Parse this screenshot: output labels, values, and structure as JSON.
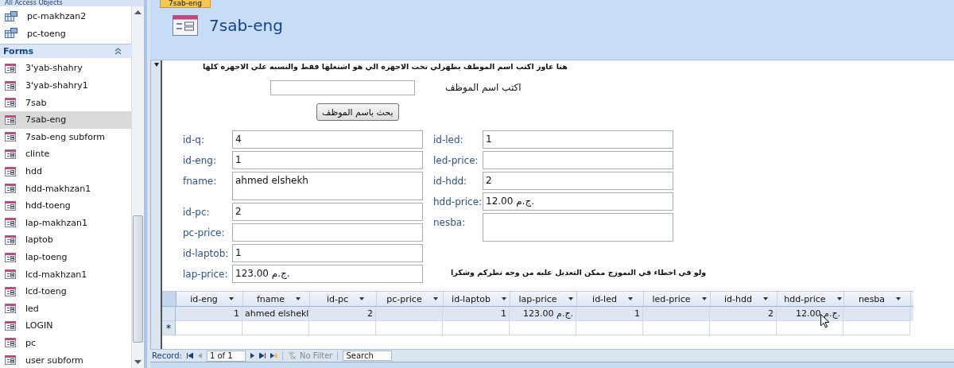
{
  "sidebar": {
    "title": "All Access Objects",
    "items": [
      {
        "label": "pc-makhzan2",
        "kind": "table",
        "selected": false
      },
      {
        "label": "pc-toeng",
        "kind": "table",
        "selected": false
      },
      {
        "label": "Forms",
        "kind": "group",
        "expanded": true
      },
      {
        "label": "3'yab-shahry",
        "kind": "form",
        "selected": false
      },
      {
        "label": "3'yab-shahry1",
        "kind": "form",
        "selected": false
      },
      {
        "label": "7sab",
        "kind": "form",
        "selected": false
      },
      {
        "label": "7sab-eng",
        "kind": "form",
        "selected": true
      },
      {
        "label": "7sab-eng subform",
        "kind": "form",
        "selected": false
      },
      {
        "label": "clinte",
        "kind": "form",
        "selected": false
      },
      {
        "label": "hdd",
        "kind": "form",
        "selected": false
      },
      {
        "label": "hdd-makhzan1",
        "kind": "form",
        "selected": false
      },
      {
        "label": "hdd-toeng",
        "kind": "form",
        "selected": false
      },
      {
        "label": "lap-makhzan1",
        "kind": "form",
        "selected": false
      },
      {
        "label": "laptob",
        "kind": "form",
        "selected": false
      },
      {
        "label": "lap-toeng",
        "kind": "form",
        "selected": false
      },
      {
        "label": "lcd-makhzan1",
        "kind": "form",
        "selected": false
      },
      {
        "label": "lcd-toeng",
        "kind": "form",
        "selected": false
      },
      {
        "label": "led",
        "kind": "form",
        "selected": false
      },
      {
        "label": "LOGIN",
        "kind": "form",
        "selected": false
      },
      {
        "label": "pc",
        "kind": "form",
        "selected": false
      },
      {
        "label": "user subform",
        "kind": "form",
        "selected": false
      }
    ]
  },
  "document_tab": {
    "label": "7sab-eng"
  },
  "form": {
    "title": "7sab-eng",
    "instruction": "هنا عاوز اكتب اسم الموظف يظهرلي تحت الاجهزه الي هو اشتغلها فقط والنسبه علي الاجهزه كلها",
    "search_label": "اكتب اسم الموظف",
    "search_button": "بحث باسم الموظف",
    "left_fields": [
      {
        "label": "id-q:",
        "value": "4",
        "kind": "single"
      },
      {
        "label": "id-eng:",
        "value": "1",
        "kind": "single"
      },
      {
        "label": "fname:",
        "value": "ahmed elshekh",
        "kind": "multi"
      },
      {
        "label": "id-pc:",
        "value": "2",
        "kind": "single"
      },
      {
        "label": "pc-price:",
        "kind": "single"
      },
      {
        "label": "id-laptob:",
        "value": "1",
        "kind": "single"
      },
      {
        "label": "lap-price:",
        "value": "123.00 ج.م.",
        "kind": "single"
      }
    ],
    "right_fields": [
      {
        "label": "id-led:",
        "value": "1",
        "kind": "single"
      },
      {
        "label": "led-price:",
        "kind": "single"
      },
      {
        "label": "id-hdd:",
        "value": "2",
        "kind": "single"
      },
      {
        "label": "hdd-price:",
        "value": "12.00 ج.م.",
        "kind": "single"
      },
      {
        "label": "nesba:",
        "kind": "multi"
      }
    ],
    "note": "ولو في اخطاء في النموزج ممكن التعديل عليه من وجه نظركم وشكرا"
  },
  "datasheet": {
    "columns": [
      {
        "label": "id-eng",
        "kind": "number"
      },
      {
        "label": "fname",
        "kind": "text"
      },
      {
        "label": "id-pc",
        "kind": "number"
      },
      {
        "label": "pc-price",
        "kind": "number"
      },
      {
        "label": "id-laptob",
        "kind": "number"
      },
      {
        "label": "lap-price",
        "kind": "number"
      },
      {
        "label": "id-led",
        "kind": "number"
      },
      {
        "label": "led-price",
        "kind": "number"
      },
      {
        "label": "id-hdd",
        "kind": "number"
      },
      {
        "label": "hdd-price",
        "kind": "number"
      },
      {
        "label": "nesba",
        "kind": "number"
      }
    ],
    "rows": [
      {
        "cells": [
          "1",
          "ahmed elshekl",
          "2",
          null,
          "1",
          "123.00 ج.م.",
          "1",
          null,
          "2",
          "12.00 ج.م.",
          null
        ]
      }
    ],
    "new_row_marker": "*"
  },
  "record_nav": {
    "label": "Record:",
    "position": "1 of 1",
    "filter": "No Filter",
    "search_placeholder": "Search"
  }
}
